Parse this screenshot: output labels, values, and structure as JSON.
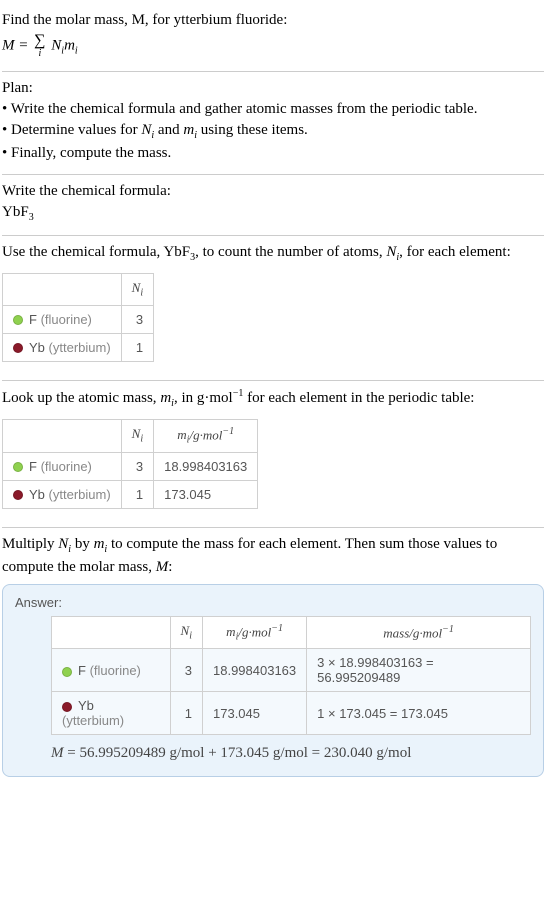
{
  "s1": {
    "line1": "Find the molar mass, M, for ytterbium fluoride:",
    "formula_left": "M = ",
    "formula_sum_var": "i",
    "formula_right1": "N",
    "formula_right2": "m"
  },
  "s2": {
    "heading": "Plan:",
    "b1": "• Write the chemical formula and gather atomic masses from the periodic table.",
    "b2_a": "• Determine values for ",
    "b2_b": " and ",
    "b2_c": " using these items.",
    "b3": "• Finally, compute the mass."
  },
  "s3": {
    "heading": "Write the chemical formula:",
    "formula_main": "YbF",
    "formula_sub": "3"
  },
  "s4": {
    "text_a": "Use the chemical formula, YbF",
    "text_sub": "3",
    "text_b": ", to count the number of atoms, ",
    "text_c": ", for each element:",
    "th_ni": "N",
    "rows": [
      {
        "sym": "F",
        "name": "(fluorine)",
        "dot": "dot-f",
        "n": "3"
      },
      {
        "sym": "Yb",
        "name": "(ytterbium)",
        "dot": "dot-yb",
        "n": "1"
      }
    ]
  },
  "s5": {
    "text_a": "Look up the atomic mass, ",
    "text_b": ", in g·mol",
    "text_c": " for each element in the periodic table:",
    "sup": "−1",
    "th_mi": "m",
    "unit": "/g·mol",
    "rows": [
      {
        "sym": "F",
        "name": "(fluorine)",
        "dot": "dot-f",
        "n": "3",
        "m": "18.998403163"
      },
      {
        "sym": "Yb",
        "name": "(ytterbium)",
        "dot": "dot-yb",
        "n": "1",
        "m": "173.045"
      }
    ]
  },
  "s6": {
    "text_a": "Multiply ",
    "text_b": " by ",
    "text_c": " to compute the mass for each element. Then sum those values to compute the molar mass, ",
    "text_d": ":",
    "answer_label": "Answer:",
    "th_mass": "mass/g·mol",
    "rows": [
      {
        "sym": "F",
        "name": "(fluorine)",
        "dot": "dot-f",
        "n": "3",
        "m": "18.998403163",
        "mass": "3 × 18.998403163 = 56.995209489"
      },
      {
        "sym": "Yb",
        "name": "(ytterbium)",
        "dot": "dot-yb",
        "n": "1",
        "m": "173.045",
        "mass": "1 × 173.045 = 173.045"
      }
    ],
    "final": "M = 56.995209489 g/mol + 173.045 g/mol = 230.040 g/mol"
  }
}
